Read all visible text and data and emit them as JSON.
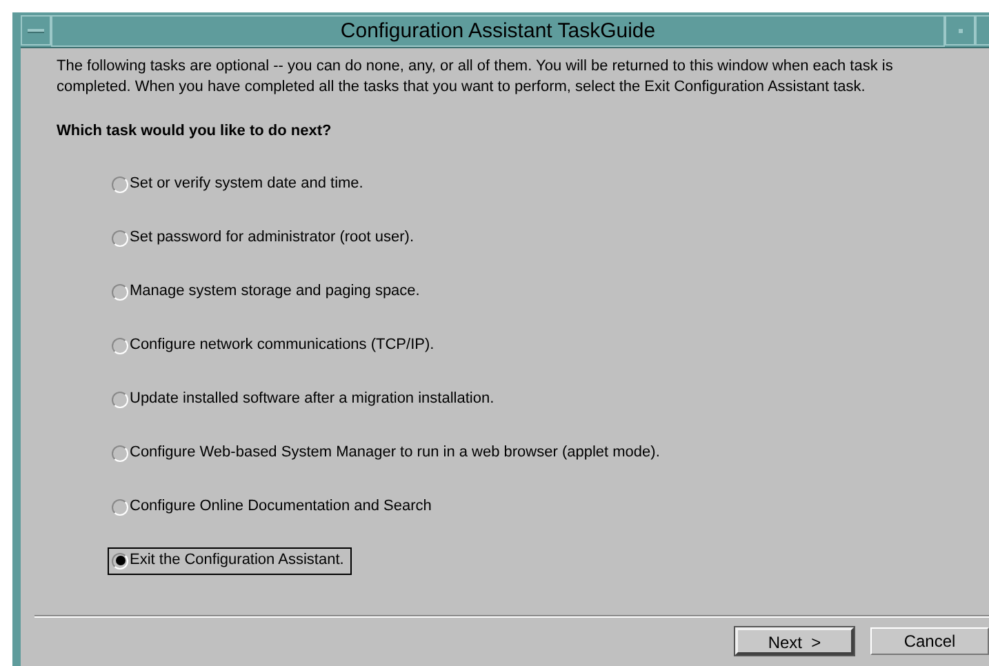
{
  "window": {
    "title": "Configuration Assistant TaskGuide"
  },
  "intro": "The following tasks are optional -- you can do none, any, or all of them.  You will be returned to this window when each task is completed.  When you have completed all the tasks that you want to perform, select the Exit Configuration Assistant task.",
  "question": "Which task would you like to do next?",
  "tasks": [
    {
      "label": "Set or verify system date and time.",
      "selected": false
    },
    {
      "label": "Set password for administrator (root user).",
      "selected": false
    },
    {
      "label": "Manage system storage and paging space.",
      "selected": false
    },
    {
      "label": "Configure network communications (TCP/IP).",
      "selected": false
    },
    {
      "label": "Update installed software after a migration installation.",
      "selected": false
    },
    {
      "label": "Configure Web-based System Manager to run in a web browser (applet mode).",
      "selected": false
    },
    {
      "label": "Configure Online Documentation and Search",
      "selected": false
    },
    {
      "label": "Exit the Configuration Assistant.",
      "selected": true
    }
  ],
  "buttons": [
    {
      "label": "Next  >",
      "kind": "default"
    },
    {
      "label": "Cancel",
      "kind": "normal"
    }
  ]
}
